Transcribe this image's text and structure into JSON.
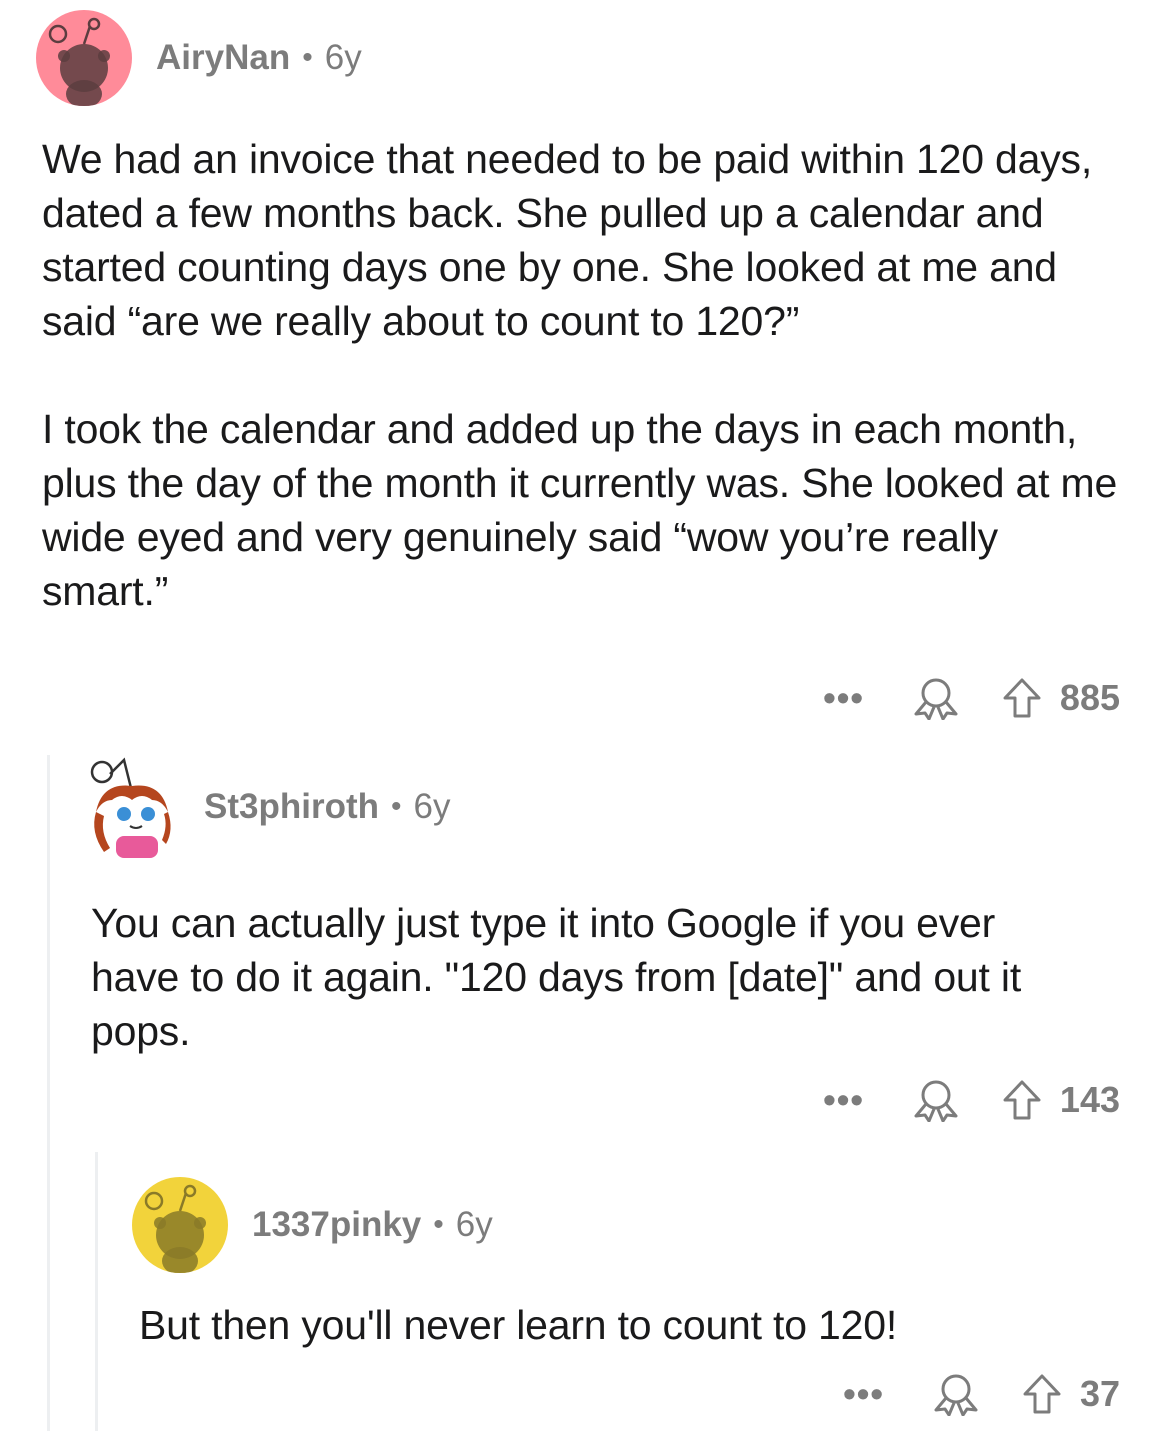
{
  "comments": [
    {
      "username": "AiryNan",
      "age": "6y",
      "avatar_color": "#ff8b99",
      "paragraphs": [
        "We had an invoice that needed to be paid within 120 days, dated a few months back. She pulled up a calendar and started counting days one by one. She looked at me and said “are we really about to count to 120?”",
        "I took the calendar and added up the days in each month, plus the day of the month it currently was. She looked at me wide eyed and very genuinely said “wow you’re really smart.”"
      ],
      "score": "885"
    },
    {
      "username": "St3phiroth",
      "age": "6y",
      "avatar_color": "#ffffff",
      "paragraphs": [
        "You can actually just type it into Google if you ever have to do it again. \"120 days from [date]\" and out it pops."
      ],
      "score": "143"
    },
    {
      "username": "1337pinky",
      "age": "6y",
      "avatar_color": "#f2d33b",
      "paragraphs": [
        "But then you'll never learn to count to 120!"
      ],
      "score": "37"
    }
  ],
  "icons": {
    "more": "more-options-icon",
    "award": "award-icon",
    "upvote": "upvote-icon"
  },
  "separator": "•",
  "more_glyph": "•••"
}
